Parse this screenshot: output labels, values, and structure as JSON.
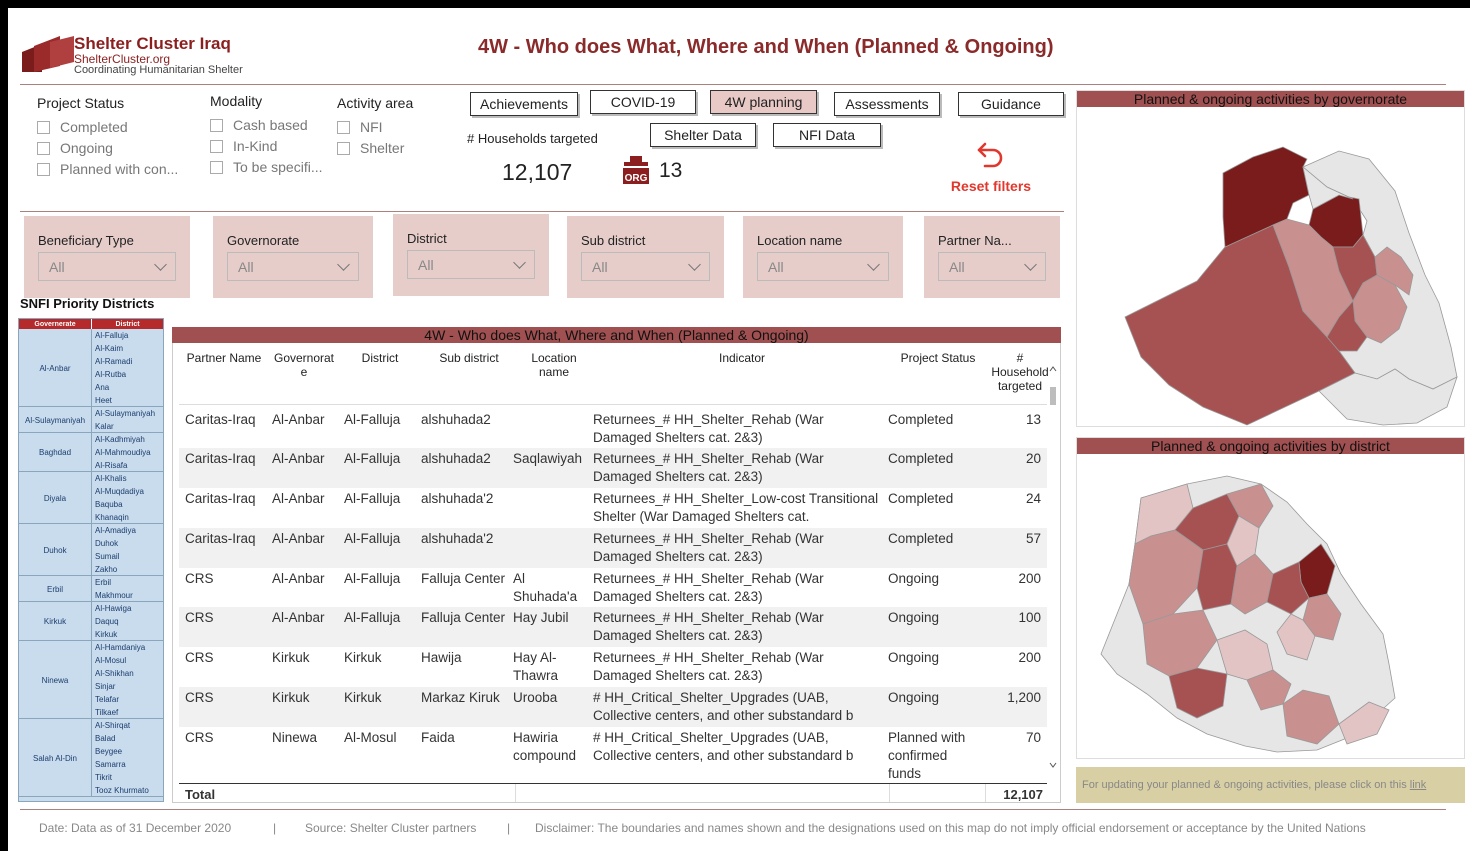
{
  "brand": {
    "title": "Shelter Cluster Iraq",
    "url": "ShelterCluster.org",
    "tagline": "Coordinating Humanitarian Shelter"
  },
  "page_title": "4W - Who does What, Where and When (Planned & Ongoing)",
  "slicers": {
    "project_status": {
      "label": "Project Status",
      "options": [
        "Completed",
        "Ongoing",
        "Planned with con..."
      ]
    },
    "modality": {
      "label": "Modality",
      "options": [
        "Cash based",
        "In-Kind",
        "To be specifi..."
      ]
    },
    "activity_area": {
      "label": "Activity area",
      "options": [
        "NFI",
        "Shelter"
      ]
    }
  },
  "nav": {
    "achievements": "Achievements",
    "covid": "COVID-19",
    "planning": "4W planning",
    "assessments": "Assessments",
    "guidance": "Guidance",
    "shelter_data": "Shelter Data",
    "nfi_data": "NFI Data"
  },
  "kpi": {
    "households_label": "# Households targeted",
    "households_value": "12,107",
    "org_badge": "ORG",
    "org_value": "13"
  },
  "reset_label": "Reset filters",
  "filters": [
    {
      "label": "Beneficiary Type",
      "value": "All"
    },
    {
      "label": "Governorate",
      "value": "All"
    },
    {
      "label": "District",
      "value": "All"
    },
    {
      "label": "Sub district",
      "value": "All"
    },
    {
      "label": "Location name",
      "value": "All"
    },
    {
      "label": "Partner Na...",
      "value": "All"
    }
  ],
  "priority": {
    "title": "SNFI Priority Districts",
    "col_gov": "Governerate",
    "col_dist": "District",
    "groups": [
      {
        "gov": "Al-Anbar",
        "districts": [
          "Al-Falluja",
          "Al-Kaim",
          "Al-Ramadi",
          "Al-Rutba",
          "Ana",
          "Heet"
        ]
      },
      {
        "gov": "Al-Sulaymaniyah",
        "districts": [
          "Al-Sulaymaniyah",
          "Kalar"
        ]
      },
      {
        "gov": "Baghdad",
        "districts": [
          "Al-Kadhmiyah",
          "Al-Mahmoudiya",
          "Al-Risafa"
        ]
      },
      {
        "gov": "Diyala",
        "districts": [
          "Al-Khalis",
          "Al-Muqdadiya",
          "Baquba",
          "Khanaqin"
        ]
      },
      {
        "gov": "Duhok",
        "districts": [
          "Al-Amadiya",
          "Duhok",
          "Sumail",
          "Zakho"
        ]
      },
      {
        "gov": "Erbil",
        "districts": [
          "Erbil",
          "Makhmour"
        ]
      },
      {
        "gov": "Kirkuk",
        "districts": [
          "Al-Hawiga",
          "Daquq",
          "Kirkuk"
        ]
      },
      {
        "gov": "Ninewa",
        "districts": [
          "Al-Hamdaniya",
          "Al-Mosul",
          "Al-Shikhan",
          "Sinjar",
          "Telafar",
          "Tilkaef"
        ]
      },
      {
        "gov": "Salah Al-Din",
        "districts": [
          "Al-Shirqat",
          "Balad",
          "Beygee",
          "Samarra",
          "Tikrit",
          "Tooz Khurmato"
        ]
      }
    ]
  },
  "table": {
    "title": "4W - Who does What, Where and When (Planned & Ongoing)",
    "headers": {
      "partner": "Partner Name",
      "governorate": "Governorat e",
      "district": "District",
      "sub_district": "Sub district",
      "location": "Location name",
      "indicator": "Indicator",
      "status": "Project Status",
      "households": "# Household targeted"
    },
    "rows": [
      {
        "partner": "Caritas-Iraq",
        "governorate": "Al-Anbar",
        "district": "Al-Falluja",
        "sub_district": "alshuhada2",
        "location": "",
        "indicator": "Returnees_# HH_Shelter_Rehab (War Damaged Shelters cat. 2&3)",
        "status": "Completed",
        "households": "13"
      },
      {
        "partner": "Caritas-Iraq",
        "governorate": "Al-Anbar",
        "district": "Al-Falluja",
        "sub_district": "alshuhada2",
        "location": "Saqlawiyah",
        "indicator": "Returnees_# HH_Shelter_Rehab (War Damaged Shelters cat. 2&3)",
        "status": "Completed",
        "households": "20"
      },
      {
        "partner": "Caritas-Iraq",
        "governorate": "Al-Anbar",
        "district": "Al-Falluja",
        "sub_district": "alshuhada'2",
        "location": "",
        "indicator": "Returnees_# HH_Shelter_Low-cost Transitional Shelter (War Damaged Shelters cat.",
        "status": "Completed",
        "households": "24"
      },
      {
        "partner": "Caritas-Iraq",
        "governorate": "Al-Anbar",
        "district": "Al-Falluja",
        "sub_district": "alshuhada'2",
        "location": "",
        "indicator": "Returnees_# HH_Shelter_Rehab (War Damaged Shelters cat. 2&3)",
        "status": "Completed",
        "households": "57"
      },
      {
        "partner": "CRS",
        "governorate": "Al-Anbar",
        "district": "Al-Falluja",
        "sub_district": "Falluja Center",
        "location": "Al Shuhada'a",
        "indicator": "Returnees_# HH_Shelter_Rehab (War Damaged Shelters cat. 2&3)",
        "status": "Ongoing",
        "households": "200"
      },
      {
        "partner": "CRS",
        "governorate": "Al-Anbar",
        "district": "Al-Falluja",
        "sub_district": "Falluja Center",
        "location": "Hay Jubil",
        "indicator": "Returnees_# HH_Shelter_Rehab (War Damaged Shelters cat. 2&3)",
        "status": "Ongoing",
        "households": "100"
      },
      {
        "partner": "CRS",
        "governorate": "Kirkuk",
        "district": "Kirkuk",
        "sub_district": "Hawija",
        "location": "Hay Al-Thawra",
        "indicator": "Returnees_# HH_Shelter_Rehab (War Damaged Shelters cat. 2&3)",
        "status": "Ongoing",
        "households": "200"
      },
      {
        "partner": "CRS",
        "governorate": "Kirkuk",
        "district": "Kirkuk",
        "sub_district": "Markaz Kiruk",
        "location": "Urooba",
        "indicator": "# HH_Critical_Shelter_Upgrades (UAB, Collective centers, and other substandard b",
        "status": "Ongoing",
        "households": "1,200"
      },
      {
        "partner": "CRS",
        "governorate": "Ninewa",
        "district": "Al-Mosul",
        "sub_district": "Faida",
        "location": "Hawiria compound",
        "indicator": "# HH_Critical_Shelter_Upgrades (UAB, Collective centers, and other substandard b",
        "status": "Planned with confirmed funds",
        "households": "70"
      }
    ],
    "total_label": "Total",
    "total_value": "12,107"
  },
  "maps": {
    "governorate_title": "Planned & ongoing activities by governorate",
    "district_title": "Planned & ongoing activities by district",
    "colors": {
      "dark": "#7a1c1c",
      "mid": "#a65252",
      "light": "#c99090",
      "pale": "#e2c4c4",
      "none": "#e6e6e6"
    }
  },
  "notice": {
    "text": "For updating your planned & ongoing activities, please click on this",
    "link": "link"
  },
  "footer": {
    "date": "Date: Data as of  31 December 2020",
    "source": "Source: Shelter Cluster partners",
    "disclaimer": "Disclaimer: The boundaries and names shown and the designations used on this map do not imply official endorsement or acceptance by the United Nations",
    "sep": "|"
  }
}
